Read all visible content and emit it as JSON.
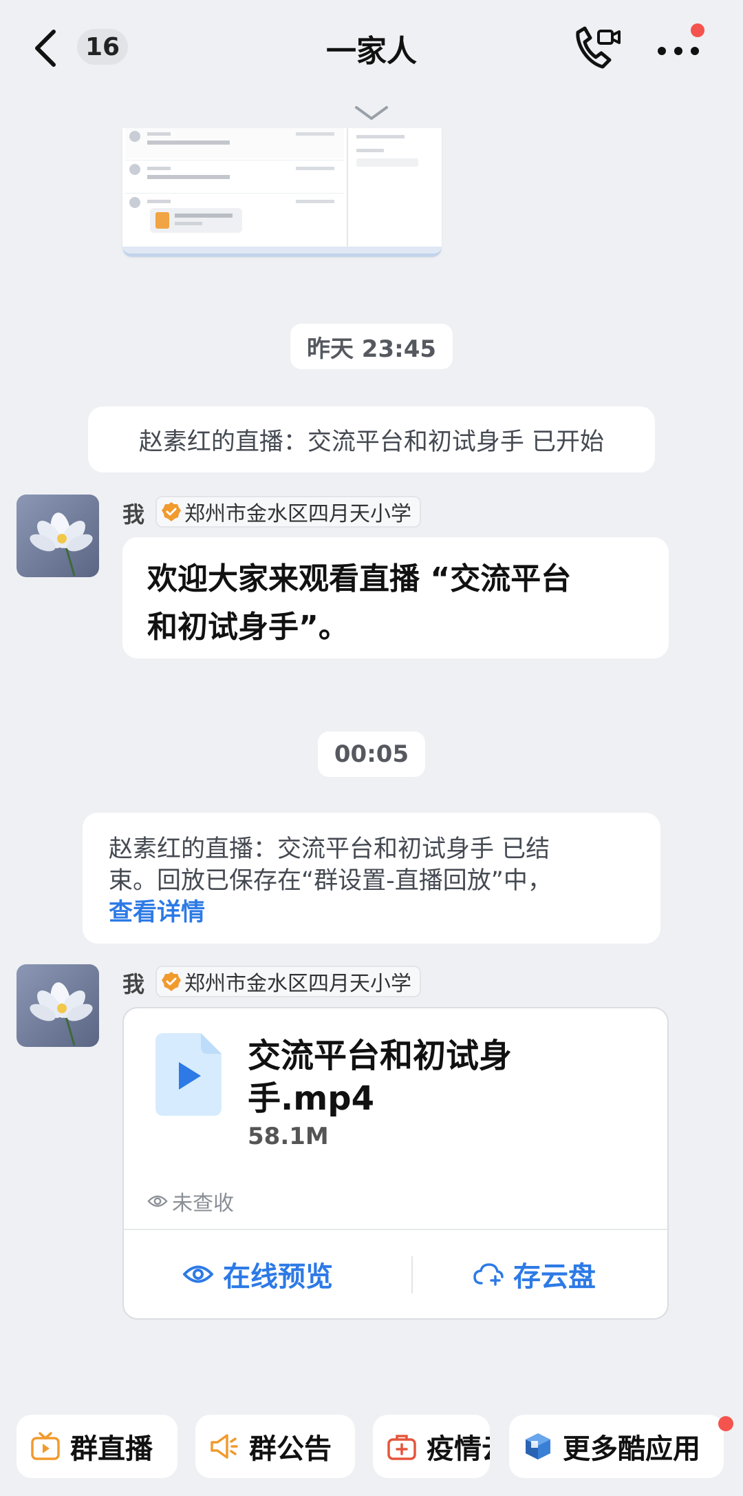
{
  "header": {
    "title": "一家人",
    "unread_count": "16"
  },
  "timeline": {
    "timestamp_1": "昨天 23:45",
    "system_start": "赵素红的直播：交流平台和初试身手 已开始",
    "timestamp_2": "00:05",
    "system_end_line1": "赵素红的直播：交流平台和初试身手 已结",
    "system_end_line2": "束。回放已保存在“群设置-直播回放”中，",
    "system_end_link": "查看详情"
  },
  "messages": [
    {
      "sender": "我",
      "org": "郑州市金水区四月天小学",
      "text_line1": "欢迎大家来观看直播 “交流平台",
      "text_line2": "和初试身手”。"
    },
    {
      "sender": "我",
      "org": "郑州市金水区四月天小学",
      "file": {
        "name_line1": "交流平台和初试身",
        "name_line2": "手.mp4",
        "size": "58.1M",
        "status": "未查收",
        "action_preview": "在线预览",
        "action_save": "存云盘"
      }
    }
  ],
  "toolbar": {
    "items": [
      {
        "label": "群直播",
        "icon": "tv-icon"
      },
      {
        "label": "群公告",
        "icon": "megaphone-icon"
      },
      {
        "label": "疫情云",
        "icon": "medkit-icon"
      },
      {
        "label": "更多酷应用",
        "icon": "cube-icon"
      }
    ]
  },
  "colors": {
    "accent": "#2d7ae6",
    "background": "#eef0f3",
    "badge_red": "#f4544d",
    "org_badge": "#f19a2e"
  }
}
